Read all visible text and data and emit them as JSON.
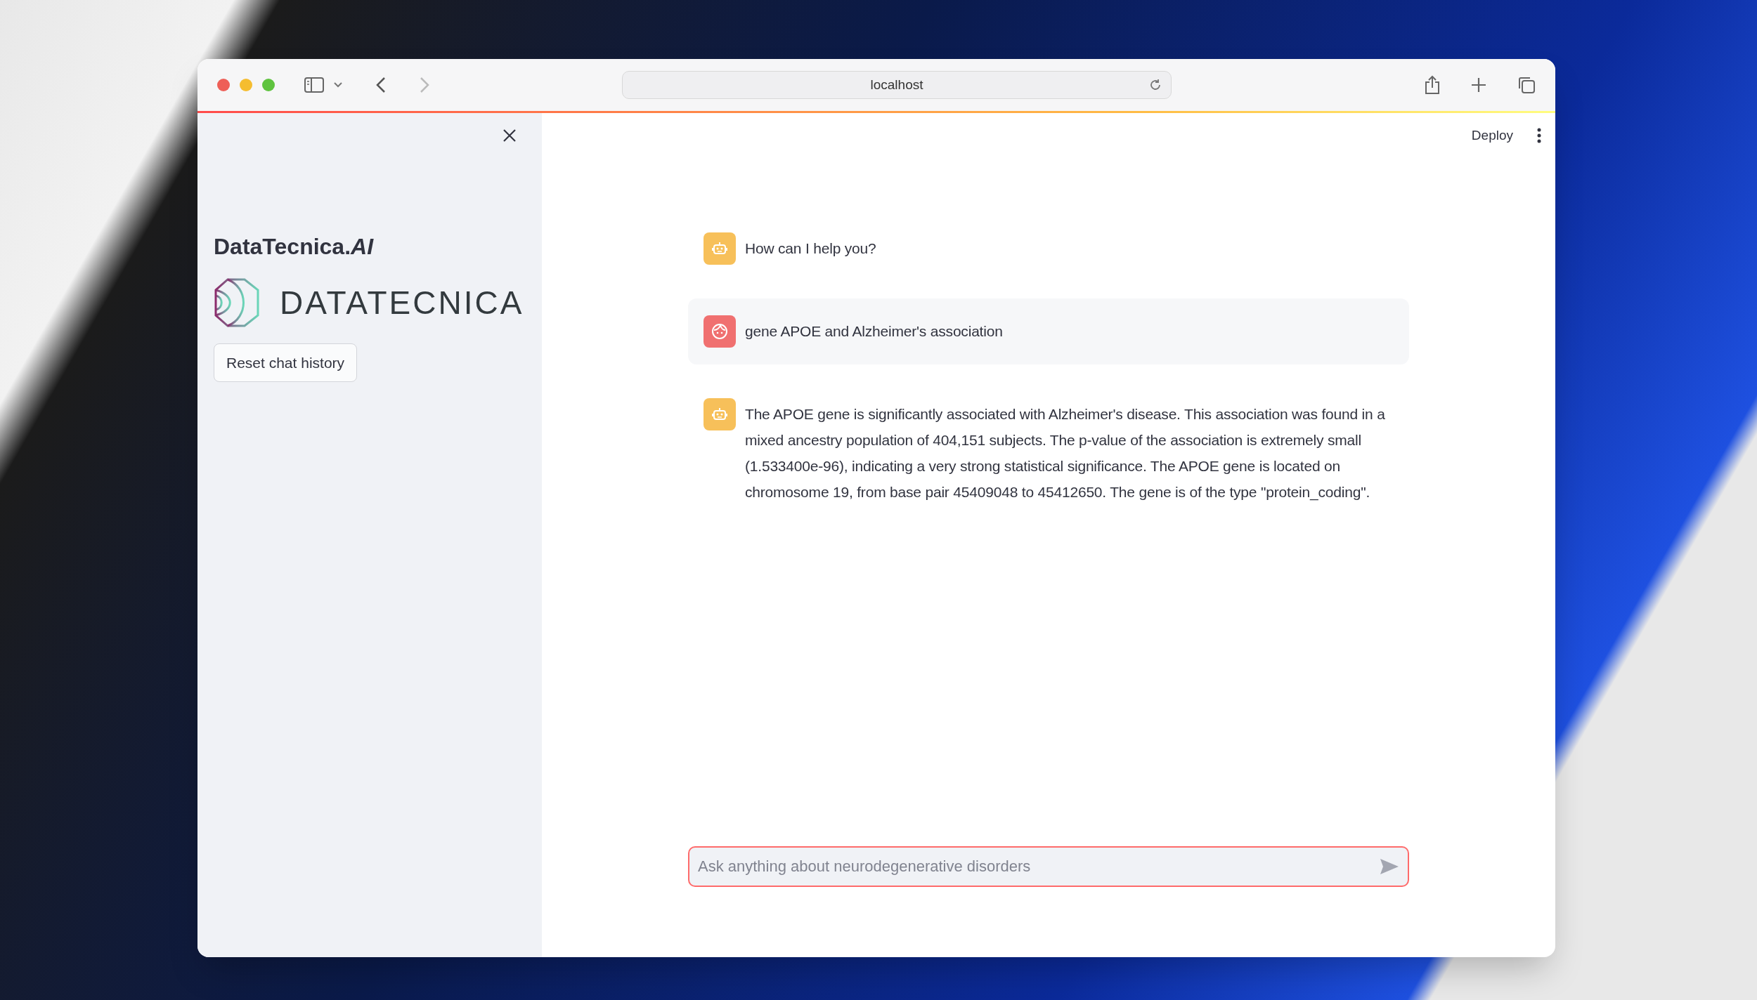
{
  "browser": {
    "url": "localhost",
    "back_disabled": false,
    "forward_disabled": true
  },
  "header": {
    "deploy_label": "Deploy"
  },
  "sidebar": {
    "title": "DataTecnica.*AI*",
    "logo_text": "DATATECNICA",
    "reset_button": "Reset chat history"
  },
  "messages": [
    {
      "kind": "assistant",
      "text": "How can I help you?"
    },
    {
      "kind": "user",
      "text": "gene APOE and Alzheimer's association"
    },
    {
      "kind": "assistant",
      "text": "The APOE gene is significantly associated with Alzheimer's disease. This association was found in a mixed ancestry population of 404,151 subjects. The p-value of the association is extremely small (1.533400e-96), indicating a very strong statistical significance. The APOE gene is located on chromosome 19, from base pair 45409048 to 45412650. The gene is of the type \"protein_coding\"."
    }
  ],
  "chat_input": {
    "placeholder": "Ask anything about neurodegenerative disorders"
  }
}
